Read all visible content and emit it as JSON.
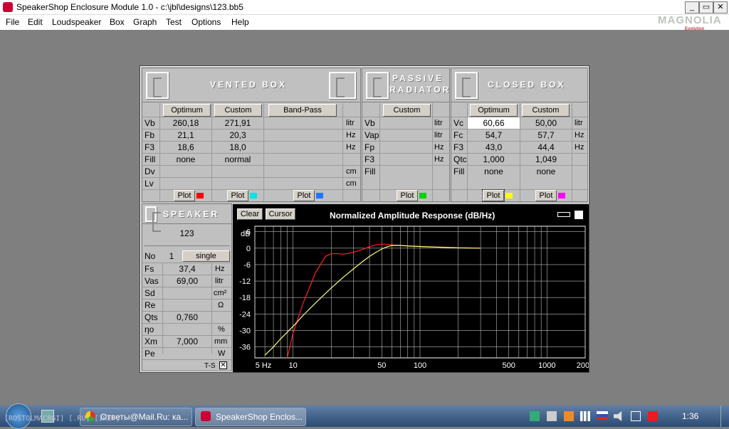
{
  "window": {
    "title": "SpeakerShop Enclosure Module 1.0 - c:\\jbl\\designs\\123.bb5",
    "min": "_",
    "max": "▭",
    "close": "✕"
  },
  "menu": [
    "File",
    "Edit",
    "Loudspeaker",
    "Box",
    "Graph",
    "Test",
    "Options",
    "Help"
  ],
  "watermark": {
    "main": "MAGNOLIA",
    "sub": "Evolution"
  },
  "vented": {
    "title": "VENTED BOX",
    "opt_btn": "Optimum",
    "cust_btn": "Custom",
    "bp_btn": "Band-Pass",
    "rows": [
      {
        "label": "Vb",
        "opt": "260,18",
        "cust": "271,91",
        "bp": "",
        "unit": "litr"
      },
      {
        "label": "Fb",
        "opt": "21,1",
        "cust": "20,3",
        "bp": "",
        "unit": "Hz"
      },
      {
        "label": "F3",
        "opt": "18,6",
        "cust": "18,0",
        "bp": "",
        "unit": "Hz"
      },
      {
        "label": "Fill",
        "opt": "none",
        "cust": "normal",
        "bp": "",
        "unit": ""
      },
      {
        "label": "Dv",
        "opt": "",
        "cust": "",
        "bp": "",
        "unit": "cm"
      },
      {
        "label": "Lv",
        "opt": "",
        "cust": "",
        "bp": "",
        "unit": "cm"
      }
    ],
    "plot": "Plot",
    "colors": [
      "#ff0000",
      "#00e5e5",
      "#1e78ff"
    ]
  },
  "passive": {
    "title1": "PASSIVE",
    "title2": "RADIATOR",
    "cust_btn": "Custom",
    "rows": [
      {
        "label": "Vb",
        "unit": "litr"
      },
      {
        "label": "Vap",
        "unit": "litr"
      },
      {
        "label": "Fp",
        "unit": "Hz"
      },
      {
        "label": "F3",
        "unit": "Hz"
      },
      {
        "label": "Fill",
        "unit": ""
      }
    ],
    "plot": "Plot",
    "color": "#00d000"
  },
  "closed": {
    "title": "CLOSED BOX",
    "opt_btn": "Optimum",
    "cust_btn": "Custom",
    "rows": [
      {
        "label": "Vc",
        "opt": "60,66",
        "cust": "50,00",
        "unit": "litr"
      },
      {
        "label": "Fc",
        "opt": "54,7",
        "cust": "57,7",
        "unit": "Hz"
      },
      {
        "label": "F3",
        "opt": "43,0",
        "cust": "44,4",
        "unit": "Hz"
      },
      {
        "label": "Qtc",
        "opt": "1,000",
        "cust": "1,049",
        "unit": ""
      },
      {
        "label": "Fill",
        "opt": "none",
        "cust": "none",
        "unit": ""
      }
    ],
    "plot": "Plot",
    "colors": [
      "#ffff00",
      "#ff00ff"
    ]
  },
  "speaker": {
    "title": "SPEAKER",
    "name": "123",
    "no_label": "No",
    "no": "1",
    "mode": "single",
    "rows": [
      {
        "label": "Fs",
        "value": "37,4",
        "unit": "Hz"
      },
      {
        "label": "Vas",
        "value": "69,00",
        "unit": "litr"
      },
      {
        "label": "Sd",
        "value": "",
        "unit": "cm²"
      },
      {
        "label": "Re",
        "value": "",
        "unit": "Ω"
      },
      {
        "label": "Qts",
        "value": "0,760",
        "unit": ""
      },
      {
        "label": "ηo",
        "value": "",
        "unit": "%"
      },
      {
        "label": "Xm",
        "value": "7,000",
        "unit": "mm"
      },
      {
        "label": "Pe",
        "value": "",
        "unit": "W"
      }
    ],
    "ts": "T-S"
  },
  "graph": {
    "clear": "Clear",
    "cursor": "Cursor"
  },
  "chart_data": {
    "type": "line",
    "title": "Normalized Amplitude Response (dB/Hz)",
    "ylabel": "dB",
    "xscale": "log",
    "xlim": [
      5,
      2000
    ],
    "ylim": [
      -40,
      8
    ],
    "xticks": [
      5,
      10,
      50,
      100,
      500,
      1000,
      2000
    ],
    "xticklabels": [
      "5 Hz",
      "10",
      "50",
      "100",
      "500",
      "1000",
      "2000"
    ],
    "yticks": [
      6,
      0,
      -6,
      -12,
      -18,
      -24,
      -30,
      -36
    ],
    "yticklabels": [
      "6",
      "0",
      "-6",
      "-12",
      "-18",
      "-24",
      "-30",
      "-36"
    ],
    "series": [
      {
        "color": "#ff2020",
        "x": [
          9,
          10,
          12,
          15,
          18,
          20,
          22,
          25,
          30,
          35,
          40,
          45,
          50,
          55,
          60,
          65,
          70,
          80,
          100,
          150,
          200,
          300
        ],
        "y": [
          -40,
          -31,
          -20,
          -9,
          -3,
          -2,
          -2,
          -2.2,
          -1.5,
          -0.5,
          0.5,
          1.2,
          1.5,
          1.4,
          1.2,
          1.1,
          1,
          0.8,
          0.6,
          0.4,
          0.2,
          0
        ]
      },
      {
        "color": "#ffff80",
        "x": [
          6,
          7,
          8,
          10,
          12,
          15,
          20,
          25,
          30,
          35,
          40,
          45,
          50,
          55,
          60,
          70,
          80,
          100,
          150,
          200,
          300
        ],
        "y": [
          -39,
          -36,
          -33,
          -28.5,
          -24.5,
          -20,
          -14.5,
          -10.5,
          -7.5,
          -5,
          -3,
          -1.5,
          -0.3,
          0.5,
          1,
          1,
          0.8,
          0.6,
          0.3,
          0.1,
          0
        ]
      }
    ]
  },
  "taskbar": {
    "tasks": [
      "Ответы@Mail.Ru: ка...",
      "SpeakerShop Enclos..."
    ],
    "clock": "1:36",
    "overlay": "[ROSTOLMACRGI] [.RU] [IREF]"
  }
}
